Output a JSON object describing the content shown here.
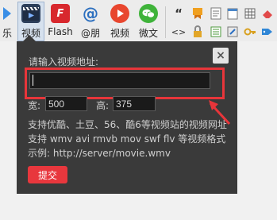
{
  "toolbar": {
    "items": [
      {
        "label": "乐",
        "icon": "music-icon"
      },
      {
        "label": "视频",
        "icon": "video-clapper-icon"
      },
      {
        "label": "Flash",
        "icon": "flash-icon"
      },
      {
        "label": "@朋",
        "icon": "at-mention-icon"
      },
      {
        "label": "视频",
        "icon": "play-video-icon"
      },
      {
        "label": "微文",
        "icon": "wechat-icon"
      }
    ],
    "mini_icons": [
      "quote-icon",
      "code-brackets-icon",
      "ribbon-icon",
      "lock-icon",
      "file-icon",
      "calendar-icon",
      "table-icon",
      "eraser-icon",
      "pencil-icon",
      "list-icon",
      "key-icon",
      "tag-icon"
    ],
    "mini_glyphs": {
      "quote": "“",
      "code": "<>"
    }
  },
  "dialog": {
    "close_glyph": "×",
    "url_label": "请输入视频地址:",
    "url_value": "",
    "width_label": "宽:",
    "width_value": "500",
    "height_label": "高:",
    "height_value": "375",
    "info_lines": [
      "支持优酷、土豆、56、酷6等视频站的视频网址",
      "支持 wmv avi rmvb mov swf flv 等视频格式",
      "示例: http://server/movie.wmv"
    ],
    "submit_label": "提交"
  },
  "colors": {
    "highlight": "#e8353a",
    "submit": "#e8373d",
    "dialog_bg": "#3a3a3a"
  }
}
